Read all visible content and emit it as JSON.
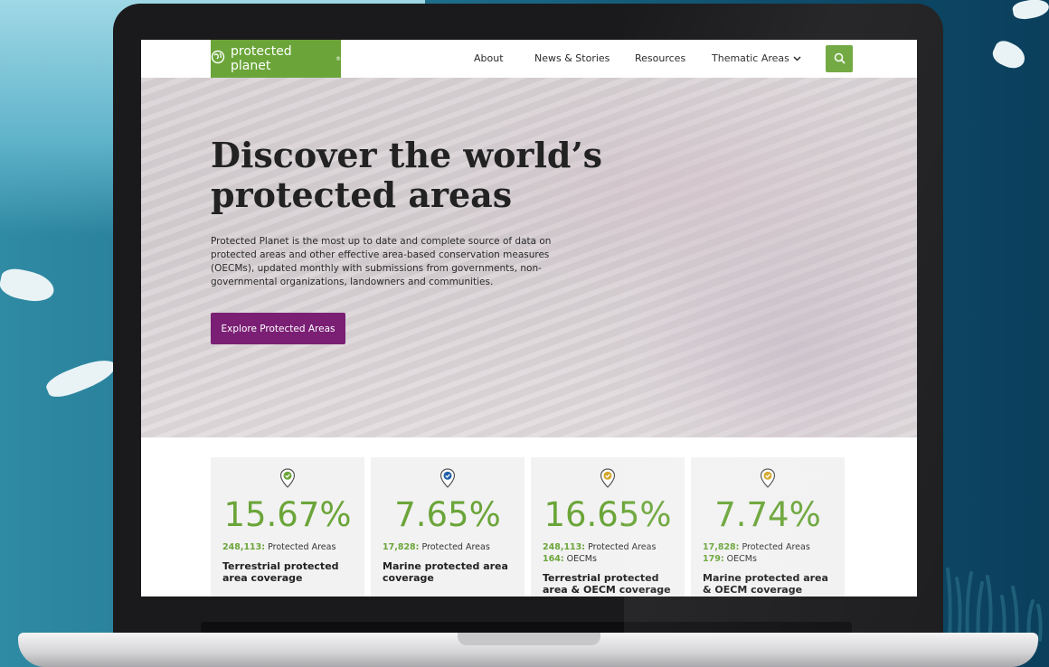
{
  "site": {
    "logo_text": "protected planet",
    "logo_mark": "®"
  },
  "nav": {
    "items": [
      {
        "label": "About"
      },
      {
        "label": "News & Stories"
      },
      {
        "label": "Resources"
      },
      {
        "label": "Thematic Areas"
      }
    ]
  },
  "hero": {
    "title": "Discover the world’s protected areas",
    "description": "Protected Planet is the most up to date and complete source of data on protected areas and other effective area-based conservation measures (OECMs), updated monthly with submissions from governments, non-governmental organizations, landowners and communities.",
    "button_label": "Explore Protected Areas"
  },
  "stats": [
    {
      "percent": "15.67%",
      "line1_num": "248,113:",
      "line1_text": " Protected Areas",
      "line2_num": "",
      "line2_text": "",
      "label": "Terrestrial protected area coverage",
      "pin_color": "#6ba539"
    },
    {
      "percent": "7.65%",
      "line1_num": "17,828:",
      "line1_text": " Protected Areas",
      "line2_num": "",
      "line2_text": "",
      "label": "Marine protected area coverage",
      "pin_color": "#1f5fa8"
    },
    {
      "percent": "16.65%",
      "line1_num": "248,113:",
      "line1_text": " Protected Areas",
      "line2_num": "164:",
      "line2_text": " OECMs",
      "label": "Terrestrial protected area & OECM coverage",
      "pin_color": "#d4a72c"
    },
    {
      "percent": "7.74%",
      "line1_num": "17,828:",
      "line1_text": " Protected Areas",
      "line2_num": "179:",
      "line2_text": " OECMs",
      "label": "Marine protected area & OECM coverage",
      "pin_color": "#d4a72c"
    }
  ],
  "colors": {
    "brand_green": "#6ba539",
    "cta_purple": "#7a1f74"
  }
}
